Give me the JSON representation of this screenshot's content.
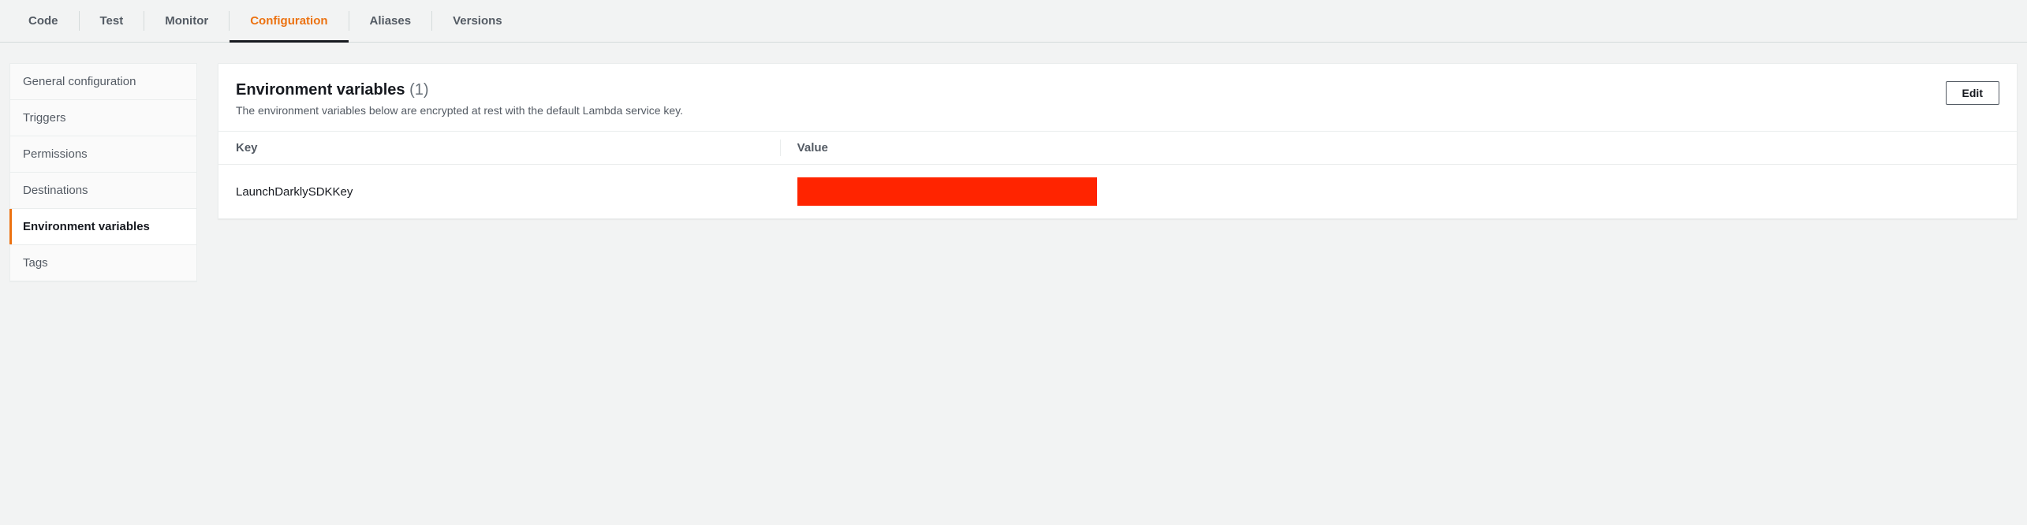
{
  "tabs": [
    {
      "label": "Code",
      "active": false
    },
    {
      "label": "Test",
      "active": false
    },
    {
      "label": "Monitor",
      "active": false
    },
    {
      "label": "Configuration",
      "active": true
    },
    {
      "label": "Aliases",
      "active": false
    },
    {
      "label": "Versions",
      "active": false
    }
  ],
  "sidebar": {
    "items": [
      {
        "label": "General configuration",
        "active": false
      },
      {
        "label": "Triggers",
        "active": false
      },
      {
        "label": "Permissions",
        "active": false
      },
      {
        "label": "Destinations",
        "active": false
      },
      {
        "label": "Environment variables",
        "active": true
      },
      {
        "label": "Tags",
        "active": false
      }
    ]
  },
  "panel": {
    "title": "Environment variables",
    "count": "(1)",
    "description": "The environment variables below are encrypted at rest with the default Lambda service key.",
    "edit_label": "Edit"
  },
  "table": {
    "headers": {
      "key": "Key",
      "value": "Value"
    },
    "rows": [
      {
        "key": "LaunchDarklySDKKey",
        "value_redacted": true
      }
    ]
  }
}
